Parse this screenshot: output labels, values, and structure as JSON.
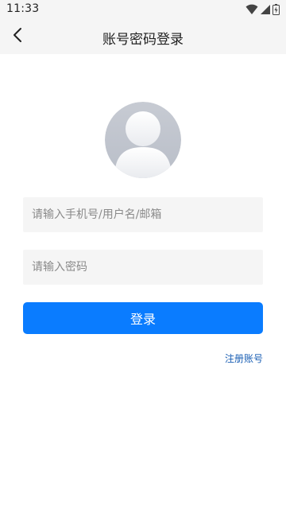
{
  "status_bar": {
    "time": "11:33",
    "icons": [
      "wifi-icon",
      "signal-icon",
      "battery-icon"
    ]
  },
  "header": {
    "back_icon": "chevron-left-icon",
    "title": "账号密码登录"
  },
  "avatar": {
    "icon": "default-user-avatar"
  },
  "form": {
    "account_placeholder": "请输入手机号/用户名/邮箱",
    "account_value": "",
    "password_placeholder": "请输入密码",
    "password_value": "",
    "login_label": "登录",
    "register_label": "注册账号"
  },
  "colors": {
    "primary": "#0a7cff",
    "link": "#1a5fb4",
    "input_bg": "#f5f5f5",
    "bar_bg": "#f5f5f5"
  }
}
